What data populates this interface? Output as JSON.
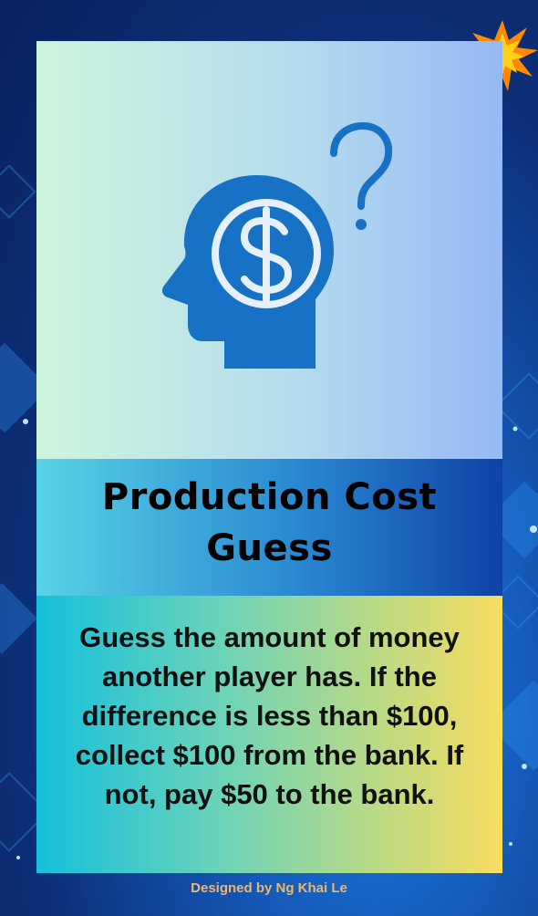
{
  "card": {
    "title": "Production Cost Guess",
    "description": "Guess the amount of money another player has. If the difference is less than $100, collect $100 from the bank. If not, pay $50 to the bank.",
    "icon": "head-dollar-question-icon",
    "corner_icon": "starburst-icon"
  },
  "footer": {
    "credit": "Designed by Ng Khai Le"
  },
  "colors": {
    "icon_blue": "#1771c4",
    "title_text": "#000000",
    "credit_text": "#f0b66a",
    "burst_outer": "#ff8a00",
    "burst_inner": "#ffd21a"
  }
}
